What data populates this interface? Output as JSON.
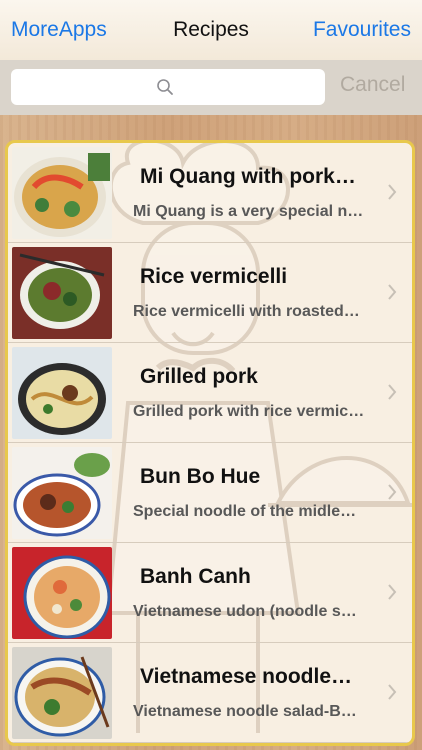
{
  "nav": {
    "left_label": "MoreApps",
    "title": "Recipes",
    "right_label": "Favourites"
  },
  "search": {
    "placeholder": "",
    "cancel_label": "Cancel"
  },
  "colors": {
    "accent": "#1b78e6",
    "card_border": "#e8c84c",
    "wood": "#d3a880"
  },
  "recipes": [
    {
      "title": "Mi Quang with pork…",
      "subtitle": "Mi Quang is a very special n…"
    },
    {
      "title": "Rice vermicelli",
      "subtitle": "Rice vermicelli with roasted…"
    },
    {
      "title": "Grilled pork",
      "subtitle": "Grilled pork with rice vermic…"
    },
    {
      "title": "Bun Bo Hue",
      "subtitle": "Special noodle of the midle…"
    },
    {
      "title": "Banh Canh",
      "subtitle": "Vietnamese udon (noodle s…"
    },
    {
      "title": "Vietnamese noodle…",
      "subtitle": "Vietnamese noodle salad-B…"
    }
  ]
}
